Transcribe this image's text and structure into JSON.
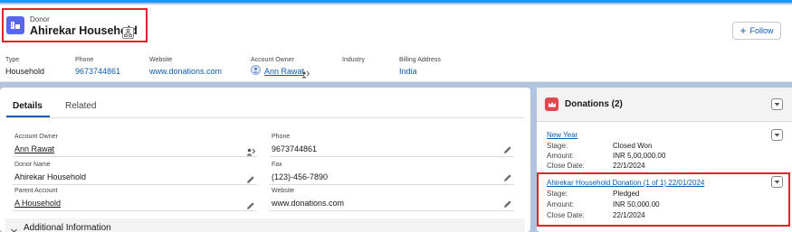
{
  "header": {
    "object_label": "Donor",
    "record_title": "Ahirekar Household",
    "follow_label": "Follow",
    "fields": [
      {
        "label": "Type",
        "value": "Household"
      },
      {
        "label": "Phone",
        "value": "9673744861"
      },
      {
        "label": "Website",
        "value": "www.donations.com"
      },
      {
        "label": "Account Owner",
        "value": "Ann Rawat"
      },
      {
        "label": "Industry",
        "value": ""
      },
      {
        "label": "Billing Address",
        "value": "India"
      }
    ]
  },
  "details": {
    "tabs": [
      {
        "label": "Details",
        "active": true
      },
      {
        "label": "Related",
        "active": false
      }
    ],
    "left_fields": [
      {
        "label": "Account Owner",
        "value": "Ann Rawat"
      },
      {
        "label": "Donor Name",
        "value": "Ahirekar Household"
      },
      {
        "label": "Parent Account",
        "value": "A Household"
      }
    ],
    "right_fields": [
      {
        "label": "Phone",
        "value": "9673744861"
      },
      {
        "label": "Fax",
        "value": "(123)-456-7890"
      },
      {
        "label": "Website",
        "value": "www.donations.com"
      }
    ],
    "section_title": "Additional Information"
  },
  "donations": {
    "title": "Donations (2)",
    "items": [
      {
        "name": "New Year",
        "rows": [
          {
            "label": "Stage:",
            "value": "Closed Won"
          },
          {
            "label": "Amount:",
            "value": "INR 5,00,000.00"
          },
          {
            "label": "Close Date:",
            "value": "22/1/2024"
          }
        ]
      },
      {
        "name": "Ahirekar Household Donation (1 of 1) 22/01/2024",
        "rows": [
          {
            "label": "Stage:",
            "value": "Pledged"
          },
          {
            "label": "Amount:",
            "value": "INR 50,000.00"
          },
          {
            "label": "Close Date:",
            "value": "22/1/2024"
          }
        ]
      }
    ]
  },
  "colors": {
    "accent": "#0b5cab",
    "highlight": "#e0242e",
    "record_icon": "#5867e8",
    "donation_icon": "#e3474e"
  },
  "icons": [
    "household-record-icon",
    "hierarchy-icon",
    "plus-icon",
    "user-avatar-icon",
    "change-owner-icon",
    "pencil-icon",
    "chevron-down-icon",
    "crown-icon"
  ]
}
